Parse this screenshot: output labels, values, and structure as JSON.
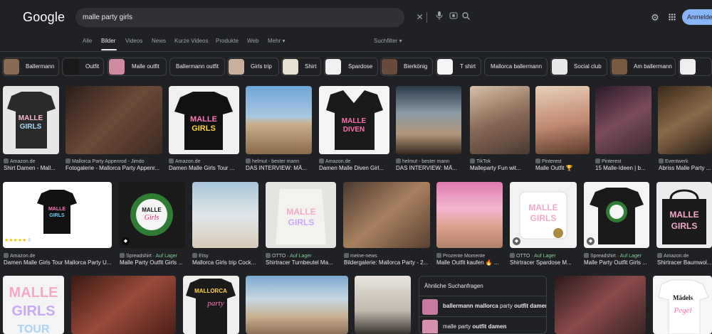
{
  "header": {
    "logo": "Google",
    "query": "malle party girls",
    "signin_label": "Anmelden"
  },
  "tabs": [
    {
      "label": "Alle"
    },
    {
      "label": "Bilder"
    },
    {
      "label": "Videos"
    },
    {
      "label": "News"
    },
    {
      "label": "Kurze Videos"
    },
    {
      "label": "Produkte"
    },
    {
      "label": "Web"
    },
    {
      "label": "Mehr ▾"
    }
  ],
  "tools_label": "Suchfilter ▾",
  "chips": [
    {
      "label": "Ballermann"
    },
    {
      "label": "Outfit"
    },
    {
      "label": "Malle outfit"
    },
    {
      "label": "Ballermann outfit"
    },
    {
      "label": "Girls trip"
    },
    {
      "label": "Shirt"
    },
    {
      "label": "Spardose"
    },
    {
      "label": "Bierkönig"
    },
    {
      "label": "T shirt"
    },
    {
      "label": "Mallorca ballermann"
    },
    {
      "label": "Social club"
    },
    {
      "label": "Am ballermann"
    }
  ],
  "results": [
    {
      "source": "Amazon.de",
      "title": "Shirt Damen - Mall...",
      "color": "#3a3a3a"
    },
    {
      "source": "Mallorca Party Appenrod - Jimdo",
      "title": "Fotogalerie - Mallorca Party Appenr...",
      "color": "#4a3428"
    },
    {
      "source": "Amazon.de",
      "title": "Damen Malle Girls Tour ...",
      "color": "#f0f0f0"
    },
    {
      "source": "helmut - bester mann",
      "title": "DAS INTERVIEW: MÄ...",
      "color": "#7aa3c4"
    },
    {
      "source": "Amazon.de",
      "title": "Damen Malle Diven Girl...",
      "color": "#f2f2f2"
    },
    {
      "source": "helmut - bester mann",
      "title": "DAS INTERVIEW: MÄ...",
      "color": "#6b7d8c"
    },
    {
      "source": "TikTok",
      "title": "Malleparty Fun wit...",
      "color": "#8a7060"
    },
    {
      "source": "Pinterest",
      "title": "Malle Outfit 🏆",
      "color": "#c9a88c"
    },
    {
      "source": "Pinterest",
      "title": "15 Malle-Ideen | b...",
      "color": "#5a3a4a"
    },
    {
      "source": "Eventwerk",
      "title": "Abriss Malle Party ...",
      "color": "#3c3228"
    },
    {
      "source": "Amazon.de",
      "title": "Damen Malle Girls Tour Mallorca Party U...",
      "color": "#ffffff"
    },
    {
      "source": "Spreadshirt",
      "stock": "Auf Lager",
      "title": "Malle Party Outfit Girls ...",
      "color": "#1a1a1a"
    },
    {
      "source": "Etsy",
      "title": "Mallorca Girls trip Cock...",
      "color": "#c8d6de"
    },
    {
      "source": "OTTO",
      "stock": "Auf Lager",
      "title": "Shirtracer Turnbeutel Ma...",
      "color": "#e6e4e0"
    },
    {
      "source": "meine-news",
      "title": "Bildergalerie: Mallorca Party - 2...",
      "color": "#6a5040"
    },
    {
      "source": "Prozente Momente",
      "title": "Malle Outfit kaufen 🔥 ...",
      "color": "#d9a5b0"
    },
    {
      "source": "OTTO",
      "stock": "Auf Lager",
      "title": "Shirtracer Spardose M...",
      "color": "#f2f2f2"
    },
    {
      "source": "Spreadshirt",
      "stock": "Auf Lager",
      "title": "Malle Party Outfit Girls ...",
      "color": "#f4f4f4"
    },
    {
      "source": "Amazon.de",
      "title": "Shirtracer Baumwol...",
      "color": "#ececec"
    }
  ],
  "row3": [
    {
      "color": "#f4f4f4"
    },
    {
      "color": "#5a2a22"
    },
    {
      "color": "#efeeec"
    },
    {
      "color": "#a3b8c8"
    },
    {
      "color": "#d8d3cc"
    },
    {
      "color": "#4a3030"
    },
    {
      "color": "#f6f6f6"
    }
  ],
  "related": {
    "heading": "Ähnliche Suchanfragen",
    "items": [
      {
        "bold": "ballermann mallorca",
        "rest": " party ",
        "bold2": "outfit damen"
      },
      {
        "bold": "",
        "rest": "malle party ",
        "bold2": "outfit damen"
      }
    ]
  },
  "rating": {
    "stars": "★★★★★",
    "count": "8",
    "value": 5
  }
}
